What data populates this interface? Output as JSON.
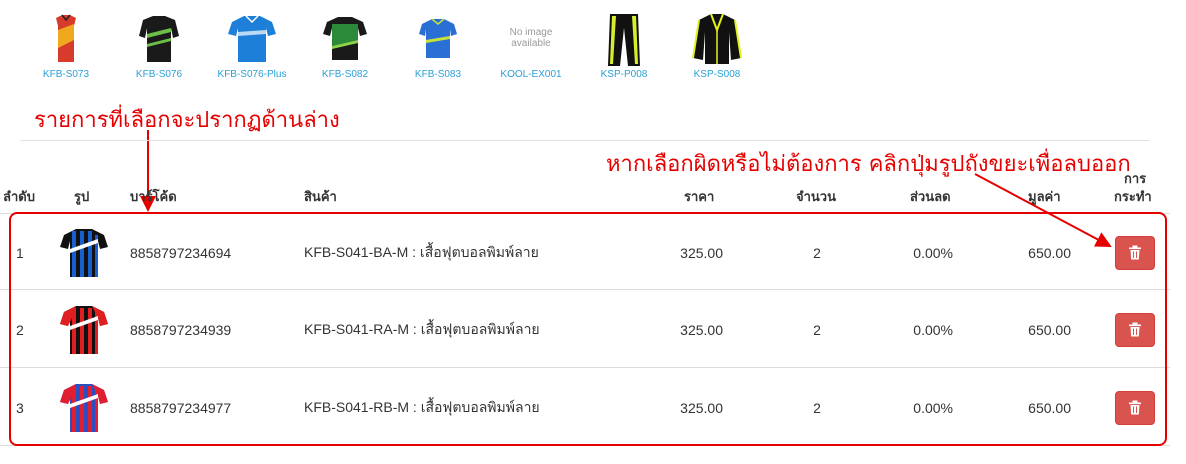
{
  "thumbnails": [
    {
      "code": "KFB-S073",
      "colors": [
        "#d63b2b",
        "#f0a81e"
      ]
    },
    {
      "code": "KFB-S076",
      "colors": [
        "#1a1a1a",
        "#6cc04a"
      ]
    },
    {
      "code": "KFB-S076-Plus",
      "colors": [
        "#1e7fd8",
        "#ffffff"
      ]
    },
    {
      "code": "KFB-S082",
      "colors": [
        "#2a8a3a",
        "#1a1a1a"
      ]
    },
    {
      "code": "KFB-S083",
      "colors": [
        "#2a6fd4",
        "#c9e23a"
      ]
    },
    {
      "code": "KOOL-EX001",
      "no_image_text": "No image available"
    },
    {
      "code": "KSP-P008",
      "colors": [
        "#111111",
        "#d7ef2a"
      ]
    },
    {
      "code": "KSP-S008",
      "colors": [
        "#111111",
        "#e4f21c"
      ]
    }
  ],
  "annotations": {
    "selected_items_note": "รายการที่เลือกจะปรากฏด้านล่าง",
    "delete_note": "หากเลือกผิดหรือไม่ต้องการ คลิกปุ่มรูปถังขยะเพื่อลบออก"
  },
  "table": {
    "headers": {
      "index": "ลำดับ",
      "image": "รูป",
      "barcode": "บาร์โค้ด",
      "product": "สินค้า",
      "price": "ราคา",
      "quantity": "จำนวน",
      "discount": "ส่วนลด",
      "value": "มูลค่า",
      "action_line1": "การ",
      "action_line2": "กระทำ"
    },
    "rows": [
      {
        "index": "1",
        "barcode": "8858797234694",
        "product": "KFB-S041-BA-M : เสื้อฟุตบอลพิมพ์ลาย",
        "price": "325.00",
        "quantity": "2",
        "discount": "0.00%",
        "value": "650.00",
        "shirt_colors": [
          "#1a5fd0",
          "#111111"
        ]
      },
      {
        "index": "2",
        "barcode": "8858797234939",
        "product": "KFB-S041-RA-M : เสื้อฟุตบอลพิมพ์ลาย",
        "price": "325.00",
        "quantity": "2",
        "discount": "0.00%",
        "value": "650.00",
        "shirt_colors": [
          "#e02020",
          "#111111"
        ]
      },
      {
        "index": "3",
        "barcode": "8858797234977",
        "product": "KFB-S041-RB-M : เสื้อฟุตบอลพิมพ์ลาย",
        "price": "325.00",
        "quantity": "2",
        "discount": "0.00%",
        "value": "650.00",
        "shirt_colors": [
          "#e02030",
          "#2a4fc0"
        ]
      }
    ],
    "delete_icon": "trash-icon"
  },
  "colors": {
    "link": "#2a9fd6",
    "annotation": "#e60000",
    "danger_button": "#d9534f"
  }
}
